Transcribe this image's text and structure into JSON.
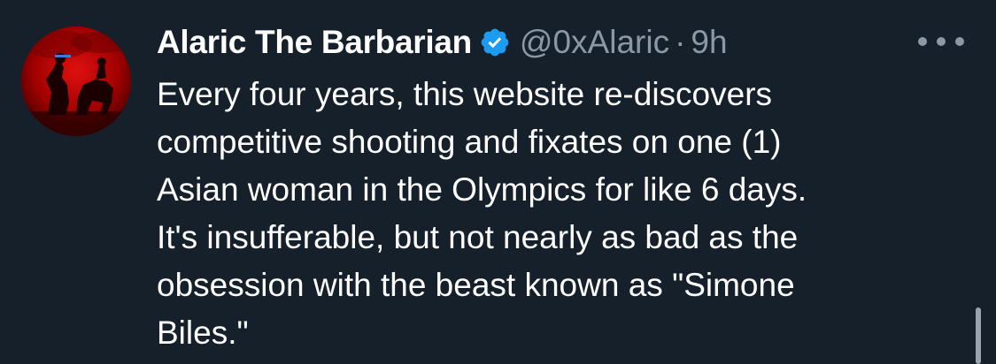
{
  "tweet": {
    "author": {
      "display_name": "Alaric The Barbarian",
      "handle": "@0xAlaric",
      "verified": true,
      "avatar_icon": "red-tinted-horse-rider-avatar"
    },
    "separator": "·",
    "time": "9h",
    "text": "Every four years, this website re-discovers\ncompetitive shooting and fixates on one (1)\nAsian woman in the Olympics for like 6 days.\nIt's insufferable, but not nearly as bad as the\nobsession with the beast known as \"Simone\nBiles.\"",
    "more_icon": "more-options-icon"
  },
  "colors": {
    "background": "#15202b",
    "text_primary": "#ffffff",
    "text_secondary": "#8b98a5",
    "verified_badge": "#1d9bf0",
    "avatar_tint": "#c00000"
  }
}
